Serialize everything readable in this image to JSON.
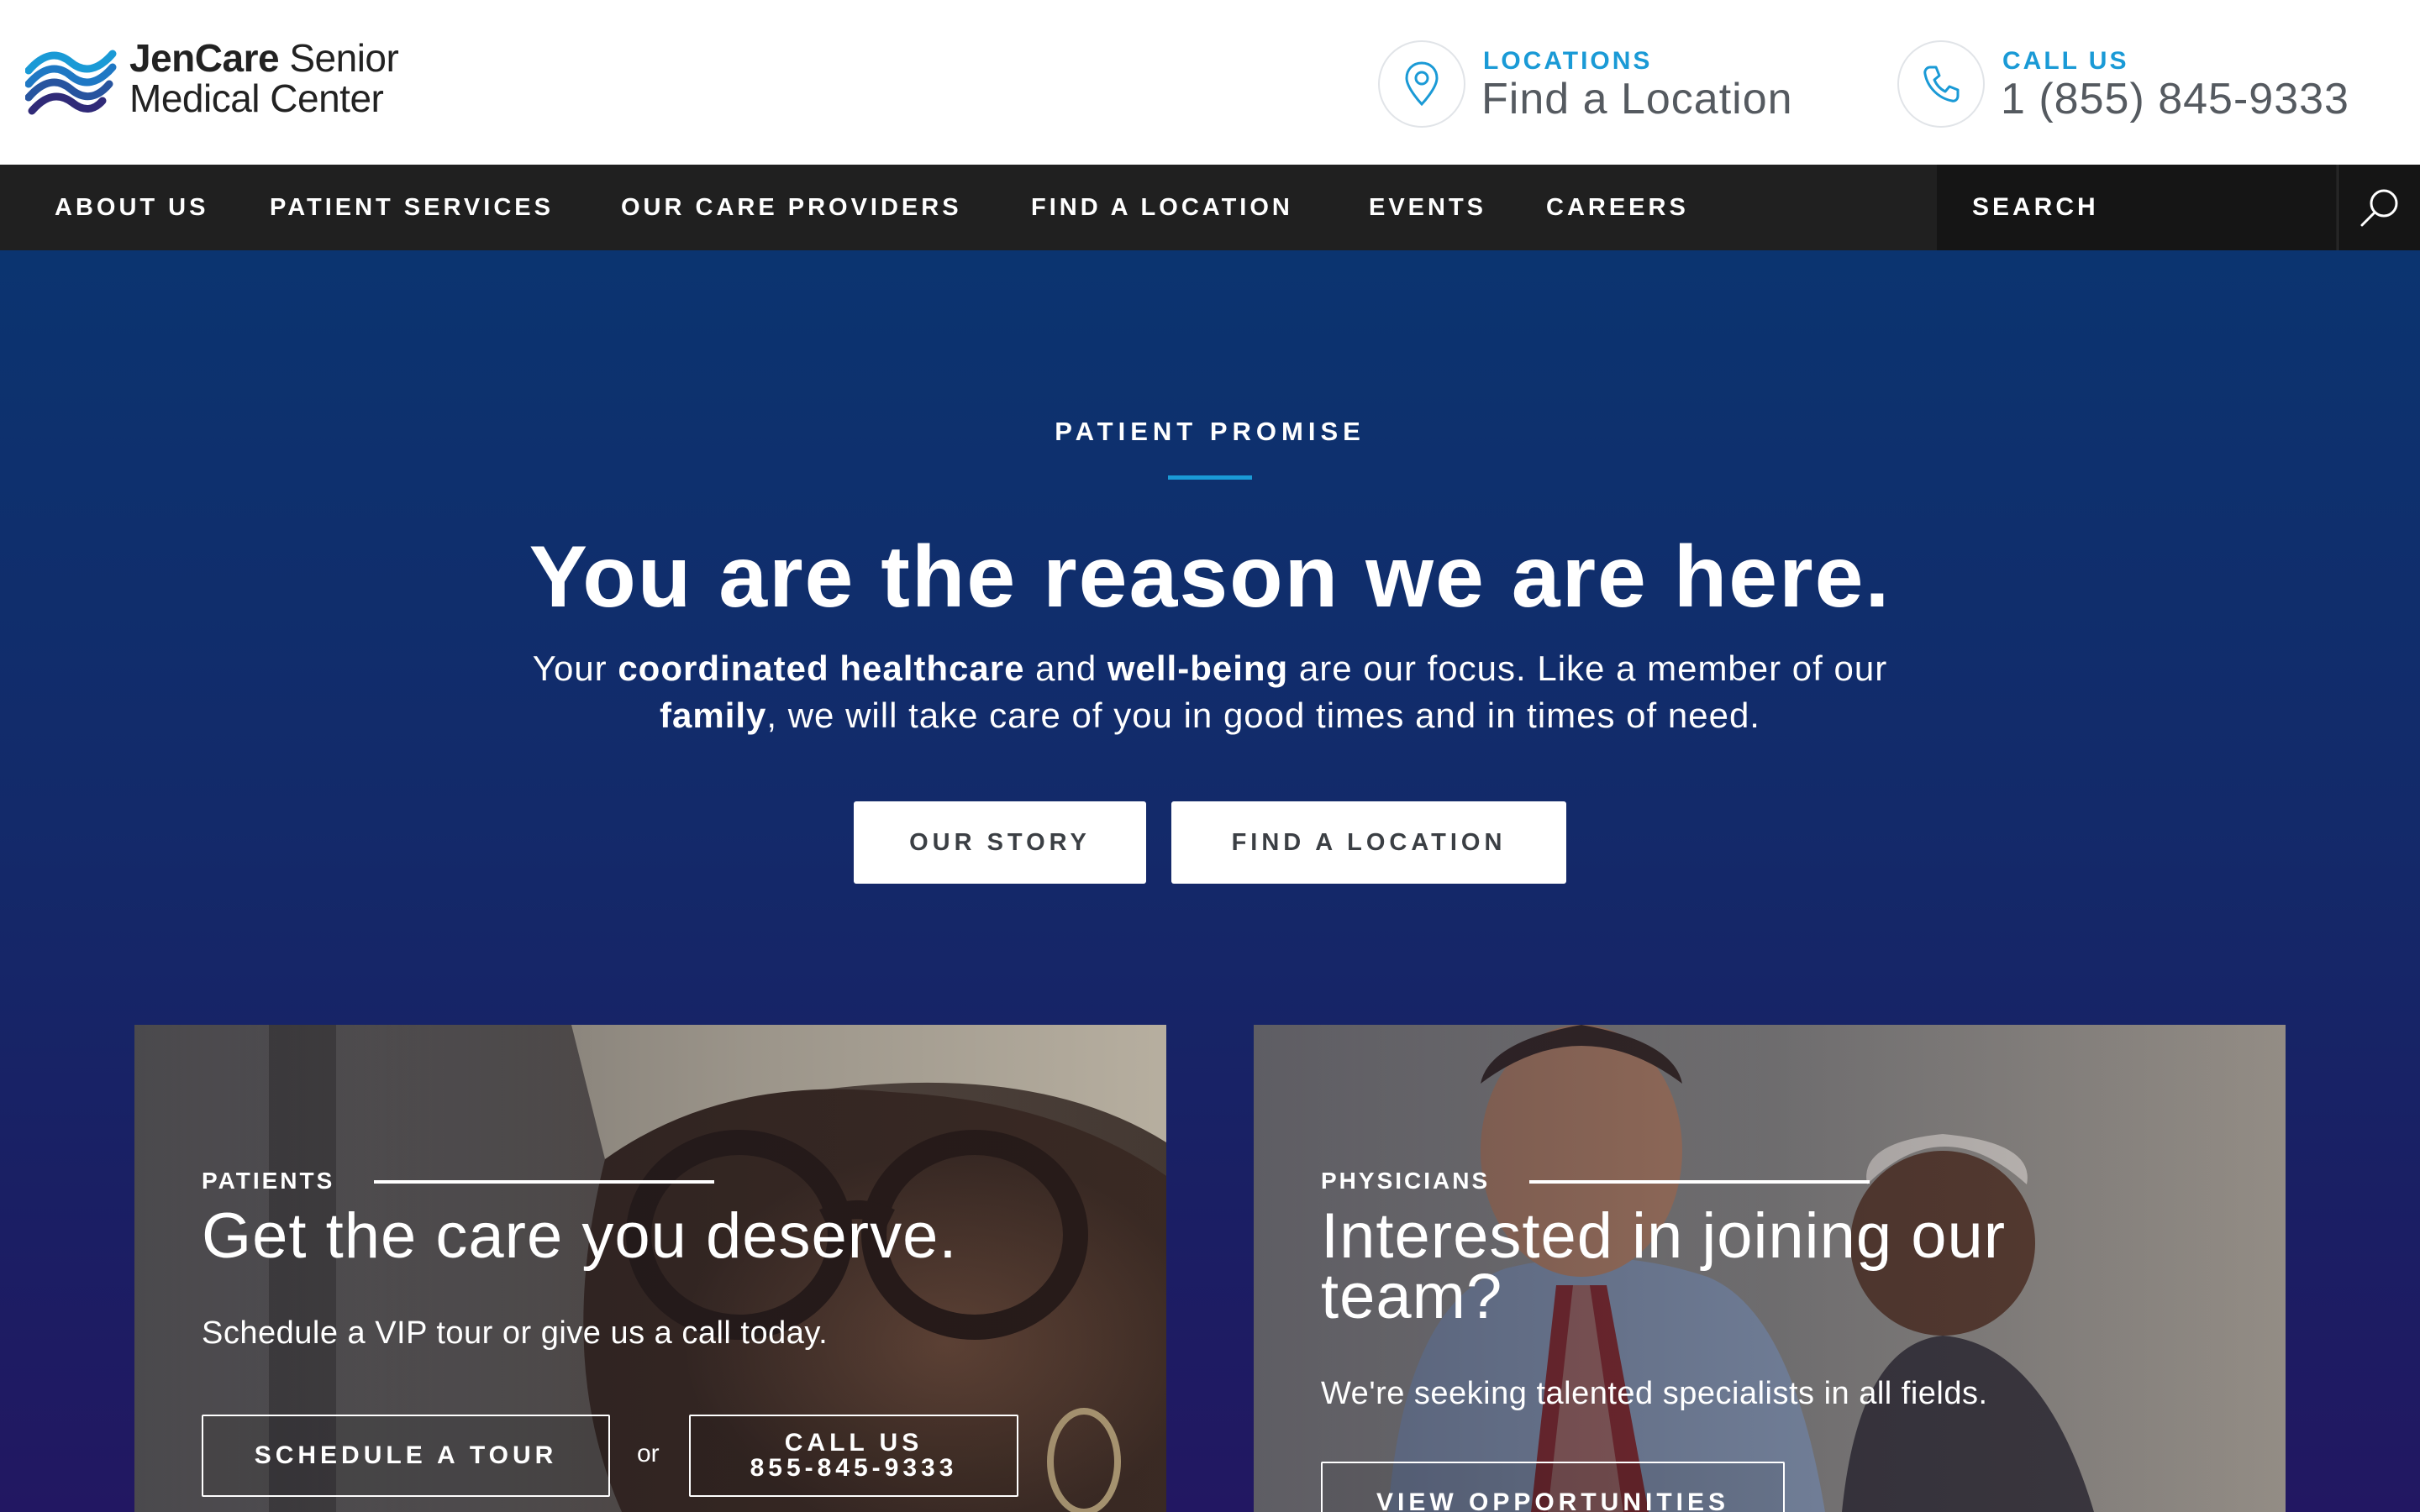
{
  "brand": {
    "name_bold": "JenCare",
    "name_rest": " Senior",
    "name_line2": "Medical Center",
    "colors": {
      "accent": "#1a9ad6",
      "navy": "#0b3470",
      "nav_bg": "#202020"
    }
  },
  "header": {
    "locations": {
      "icon": "map-pin-icon",
      "label": "LOCATIONS",
      "value": "Find a Location"
    },
    "call": {
      "icon": "phone-icon",
      "label": "CALL US",
      "value": "1 (855) 845-9333"
    }
  },
  "nav": {
    "items": [
      "ABOUT US",
      "PATIENT SERVICES",
      "OUR CARE PROVIDERS",
      "FIND A LOCATION",
      "EVENTS",
      "CAREERS"
    ],
    "search_placeholder": "SEARCH",
    "search_icon": "search-icon"
  },
  "hero": {
    "eyebrow": "PATIENT PROMISE",
    "headline_em": "You",
    "headline_rest": " are the reason we are here.",
    "sub": {
      "p1": "Your ",
      "b1": "coordinated healthcare",
      "p2": " and ",
      "b2": "well-being",
      "p3": " are our focus. Like a member of our ",
      "b3": "family",
      "p4": ", we will take care of you in good times and in times of need."
    },
    "buttons": {
      "story": "OUR STORY",
      "find": "FIND A LOCATION"
    }
  },
  "cards": {
    "patients": {
      "tag": "PATIENTS",
      "title": "Get the care you deserve.",
      "sub": "Schedule a VIP tour or give us a call today.",
      "tour_btn": "SCHEDULE A TOUR",
      "or": "or",
      "call_btn_line1": "CALL US",
      "call_btn_line2": "855-845-9333"
    },
    "physicians": {
      "tag": "PHYSICIANS",
      "title_line1": "Interested in joining our",
      "title_line2": "team?",
      "sub": "We're seeking talented specialists in all fields.",
      "btn": "VIEW OPPORTUNITIES"
    }
  }
}
